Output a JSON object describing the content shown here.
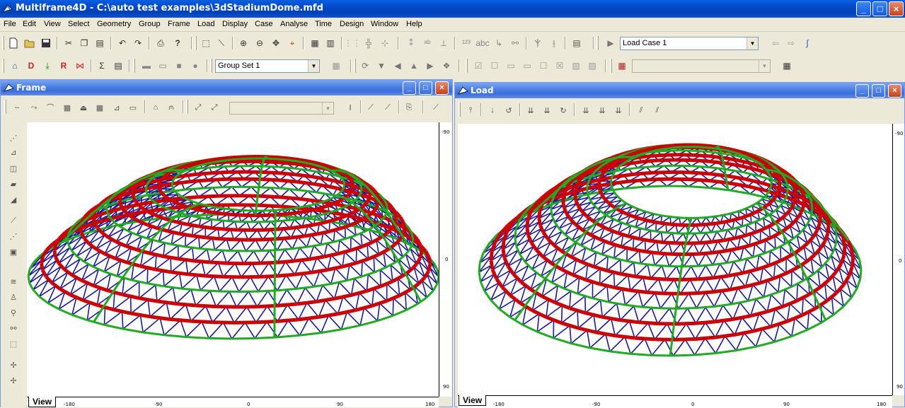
{
  "app": {
    "title": "Multiframe4D - C:\\auto test examples\\3dStadiumDome.mfd"
  },
  "window_controls": {
    "minimize": "_",
    "maximize": "□",
    "close": "×"
  },
  "menu": [
    {
      "label": "File"
    },
    {
      "label": "Edit"
    },
    {
      "label": "View"
    },
    {
      "label": "Select"
    },
    {
      "label": "Geometry"
    },
    {
      "label": "Group"
    },
    {
      "label": "Frame"
    },
    {
      "label": "Load"
    },
    {
      "label": "Display"
    },
    {
      "label": "Case"
    },
    {
      "label": "Analyse"
    },
    {
      "label": "Time"
    },
    {
      "label": "Design"
    },
    {
      "label": "Window"
    },
    {
      "label": "Help"
    }
  ],
  "toolbar": {
    "load_case_combo": "Load Case 1",
    "group_set_combo": "Group Set 1",
    "design_combo": ""
  },
  "frame_window": {
    "title": "Frame",
    "view_tab": "View",
    "combo": "",
    "ruler_v": [
      "-90",
      "0",
      "90"
    ],
    "ruler_h": [
      "-180",
      "-90",
      "0",
      "90",
      "180"
    ]
  },
  "load_window": {
    "title": "Load",
    "view_tab": "View",
    "ruler_v": [
      "-90",
      "0",
      "90"
    ],
    "ruler_h": [
      "-180",
      "-90",
      "0",
      "90",
      "180"
    ]
  },
  "colors": {
    "title_bar": "#0348c8",
    "child_title": "#4b7fe3",
    "member_red": "#cc0000",
    "member_blue": "#1a1a9a",
    "member_green": "#22aa22"
  }
}
